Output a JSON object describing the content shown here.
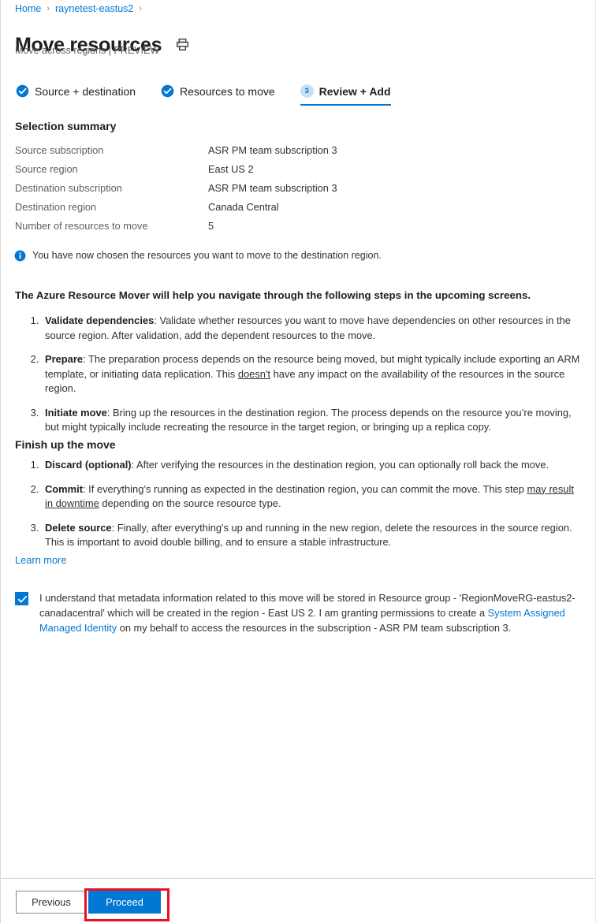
{
  "breadcrumb": {
    "items": [
      "Home",
      "raynetest-eastus2"
    ],
    "separator": "›"
  },
  "header": {
    "title": "Move resources",
    "subtitle": "Move across regions | PREVIEW",
    "print_icon": "print-icon"
  },
  "tabs": [
    {
      "label": "Source + destination",
      "state": "complete",
      "icon": "check-circle-icon"
    },
    {
      "label": "Resources to move",
      "state": "complete",
      "icon": "check-circle-icon"
    },
    {
      "label": "Review + Add",
      "state": "active",
      "number": "3"
    }
  ],
  "selection_summary": {
    "heading": "Selection summary",
    "rows": [
      {
        "key": "Source subscription",
        "value": "ASR PM team subscription 3"
      },
      {
        "key": "Source region",
        "value": "East US 2"
      },
      {
        "key": "Destination subscription",
        "value": "ASR PM team subscription 3"
      },
      {
        "key": "Destination region",
        "value": "Canada Central"
      },
      {
        "key": "Number of resources to move",
        "value": "5"
      }
    ]
  },
  "info_bar": {
    "icon": "info-icon",
    "text": "You have now chosen the resources you want to move to the destination region."
  },
  "body": {
    "lead": "The Azure Resource Mover will help you navigate through the following steps in the upcoming screens.",
    "steps_main": [
      {
        "term": "Validate dependencies",
        "term_suffix": ":",
        "text": " Validate whether resources you want to move have dependencies on other resources in the source region. After validation, add the dependent resources to the move."
      },
      {
        "term": "Prepare",
        "term_suffix": ":",
        "text_before": " The preparation process depends on the resource being moved, but might typically include exporting an ARM template, or initiating data replication. This ",
        "underlined": "doesn't",
        "text_after": " have any impact on the availability of the resources in the source region."
      },
      {
        "term": "Initiate move",
        "term_suffix": ":",
        "text": " Bring up the resources in the destination region. The process depends on the resource you’re moving, but might typically include recreating the resource in the target region, or bringing up a replica copy."
      }
    ],
    "finish_heading": "Finish up the move",
    "steps_finish": [
      {
        "term": "Discard (optional)",
        "term_suffix": ":",
        "text": " After verifying the resources in the destination region, you can optionally roll back the move."
      },
      {
        "term": "Commit",
        "term_suffix": ":",
        "text_before": " If everything’s running as expected in the destination region, you can commit the move. This step ",
        "underlined": "may result in downtime",
        "text_after": " depending on the source resource type."
      },
      {
        "term": "Delete source",
        "term_suffix": ":",
        "text": " Finally, after everything's up and running in the new region, delete the resources in the source region. This is important to avoid double billing, and to ensure a stable infrastructure."
      }
    ],
    "learn_more": "Learn more"
  },
  "consent": {
    "checked": true,
    "part1": "I understand that metadata information related to this move will be stored in Resource group - 'RegionMoveRG-eastus2-canadacentral' which will be created in the region - East US 2. I am granting permissions to create a ",
    "link": "System Assigned Managed Identity",
    "part2": " on my behalf to access the resources in the subscription - ASR PM team subscription 3."
  },
  "footer": {
    "previous_label": "Previous",
    "proceed_label": "Proceed"
  },
  "colors": {
    "accent": "#0078d4",
    "link": "#0078d4",
    "annotation": "#e81123",
    "tab_badge_bg": "#c7e0f4",
    "text": "#323130"
  }
}
